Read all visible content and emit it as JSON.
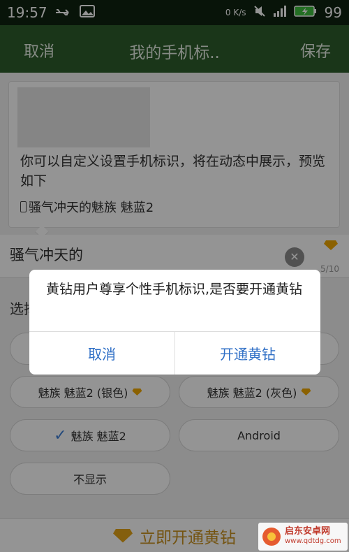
{
  "status_bar": {
    "time": "19:57",
    "net_speed": "0 K/s",
    "battery": "99",
    "usb_icon": "usb-icon",
    "image_icon": "image-icon"
  },
  "title_bar": {
    "cancel": "取消",
    "title": "我的手机标..",
    "save": "保存"
  },
  "preview": {
    "description": "你可以自定义设置手机标识，将在动态中展示，预览如下",
    "sample_line": "骚气冲天的魅族 魅蓝2"
  },
  "name_input": {
    "value": "骚气冲天的",
    "counter": "5/10"
  },
  "section": {
    "label": "选择"
  },
  "options": [
    {
      "label": "魅族 魅蓝2 (银色)",
      "premium": true
    },
    {
      "label": "魅族 魅蓝2 (灰色)",
      "premium": true
    },
    {
      "label": "魅族 魅蓝2",
      "selected": true
    },
    {
      "label": "Android"
    },
    {
      "label": "不显示"
    }
  ],
  "dialog": {
    "message": "黄钻用户尊享个性手机标识,是否要开通黄钻",
    "cancel": "取消",
    "confirm": "开通黄钻"
  },
  "bottom_bar": {
    "label": "立即开通黄钻"
  },
  "watermark": {
    "name": "启东安卓网",
    "url": "www.qdtdg.com"
  },
  "colors": {
    "title_bar": "#2e5d2c",
    "accent_blue": "#2f6fc6",
    "gold": "#e4a417"
  }
}
